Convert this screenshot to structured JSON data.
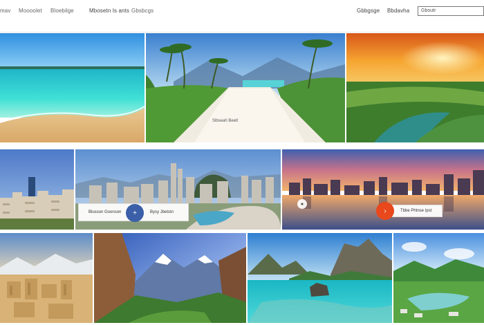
{
  "nav": {
    "links": [
      "mav",
      "Moooolet",
      "Bloebilge",
      "Mbosetn Is ants",
      "Gbsbcgs"
    ],
    "right_links": [
      "Gbbgsge",
      "Bbdavha"
    ],
    "search_value": "Gboutr"
  },
  "tiles": {
    "beach_caption": "Slbseah Beetl",
    "city_pill": "Blusson Goonson",
    "city_pill_right": "Bysy Jbetstn",
    "harbor_pill": "Tbbe Phtnse Ipst"
  },
  "icons": {
    "plus_button": "plus-icon",
    "arrow_button": "chevron-right-icon",
    "dot_button": "dot-icon"
  },
  "colors": {
    "plus_button_bg": "#3b5fa8",
    "arrow_button_bg": "#e8481c"
  }
}
